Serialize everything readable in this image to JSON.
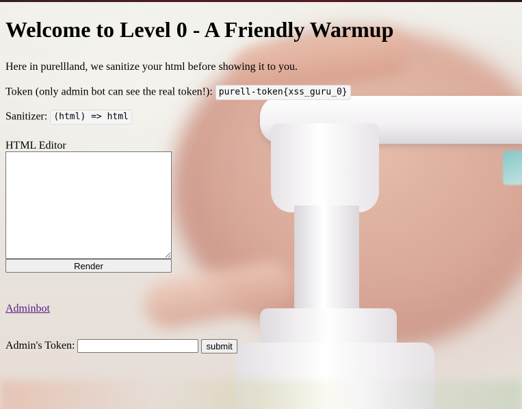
{
  "page": {
    "title": "Welcome to Level 0 - A Friendly Warmup",
    "intro": "Here in purellland, we sanitize your html before showing it to you.",
    "token_label": "Token (only admin bot can see the real token!):",
    "token_value": "purell-token{xss_guru_0}",
    "sanitizer_label": "Sanitizer:",
    "sanitizer_value": "(html) => html"
  },
  "editor": {
    "label": "HTML Editor",
    "value": "",
    "render_label": "Render"
  },
  "adminbot": {
    "link_text": "Adminbot"
  },
  "admin_token_form": {
    "label": "Admin's Token:",
    "value": "",
    "submit_label": "submit"
  },
  "colors": {
    "link_visited": "#551a8b",
    "button_bg": "#efefef",
    "code_bg": "#f5f5f5"
  }
}
